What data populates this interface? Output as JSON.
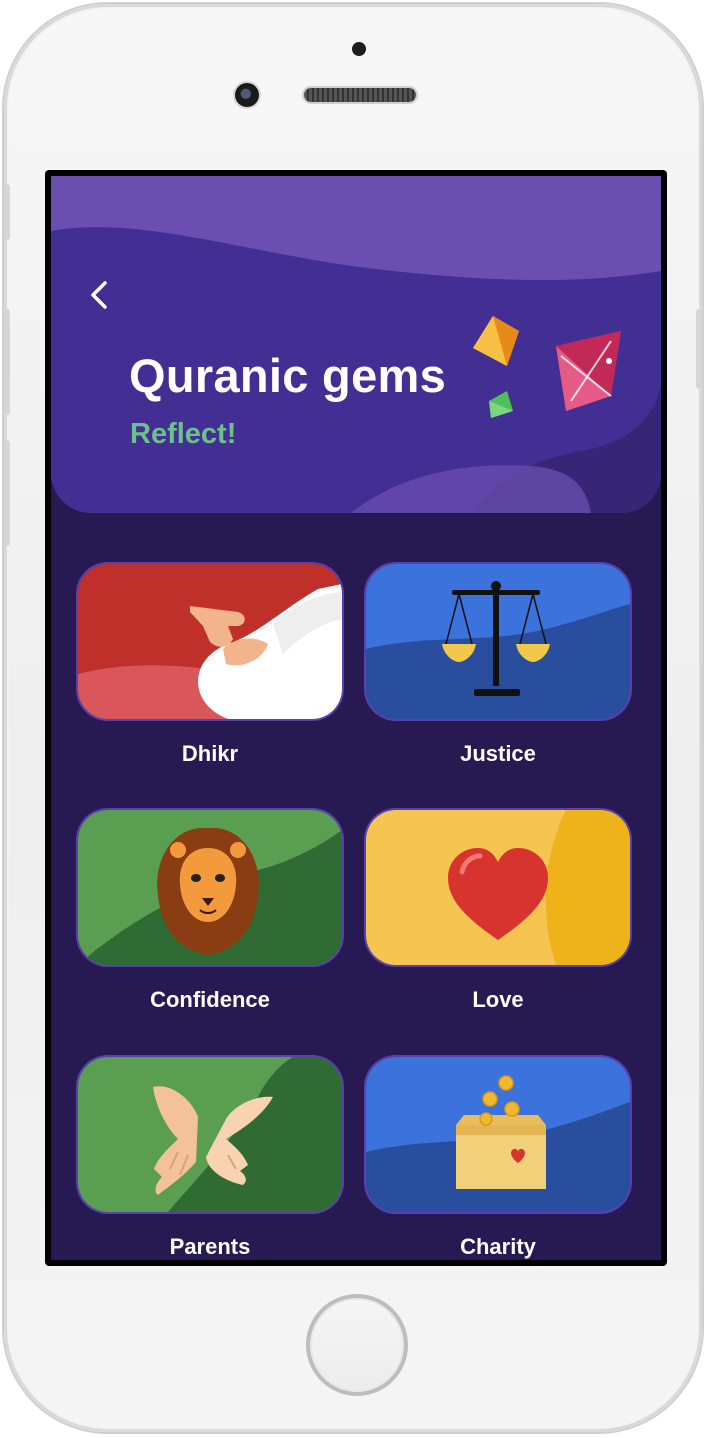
{
  "header": {
    "title": "Quranic gems",
    "subtitle": "Reflect!"
  },
  "categories": [
    {
      "label": "Dhikr",
      "icon": "pointing-finger-icon",
      "color": "#c0302b"
    },
    {
      "label": "Justice",
      "icon": "scales-icon",
      "color": "#3b72dc"
    },
    {
      "label": "Confidence",
      "icon": "lion-icon",
      "color": "#5a9e52"
    },
    {
      "label": "Love",
      "icon": "heart-icon",
      "color": "#f5c451"
    },
    {
      "label": "Parents",
      "icon": "hands-icon",
      "color": "#5a9e52"
    },
    {
      "label": "Charity",
      "icon": "donation-box-icon",
      "color": "#3b72dc"
    }
  ],
  "colors": {
    "background": "#271a52",
    "header": "#432e94",
    "accent_green": "#6cc08a"
  }
}
